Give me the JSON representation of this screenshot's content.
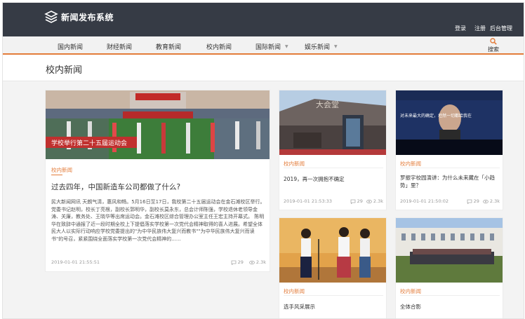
{
  "header": {
    "site_title": "新闻发布系统",
    "links": {
      "login": "登录",
      "register": "注册",
      "admin": "后台管理"
    }
  },
  "nav": {
    "items": [
      {
        "label": "国内新闻"
      },
      {
        "label": "财经新闻"
      },
      {
        "label": "教育新闻"
      },
      {
        "label": "校内新闻"
      },
      {
        "label": "国际新闻"
      },
      {
        "label": "娱乐新闻"
      }
    ],
    "search_label": "搜索"
  },
  "section": {
    "title": "校内新闻"
  },
  "featured": {
    "category": "校内新闻",
    "title": "过去四年，中国新造车公司都做了什么?",
    "summary": "民大新闻网讯 天朗气清，惠风和畅。5月16日至17日，我校第二十五届运动会在金石滩校区举行。党委书记赵明，校长丁亮根，副校长郭明华，副校长莫永东，总会计师陈强，学校退休老领导金涛、关廉，教务处、王晓华等出席运动会。金石滩校区综合管理办公室主任王宏主持开幕式。 陈明华在致辞中通报了近一段时期全校上下提倡落实学校第一次党代会精神取得的喜人进展。希望全体民大人以实际行动响应学校党委提出的\"为中华民族伟大复兴而教书\"\"为中华民族伟大复兴而读书\"的号召，紧紧围绕全面落实学校第一次党代会精神的......",
    "time": "2019-01-01 21:55:51",
    "comments": "29",
    "views": "2.3k",
    "banner_text": "学校举行第二十五届运动会"
  },
  "cards": [
    {
      "category": "校内新闻",
      "title": "2019，再一次拥抱不确定",
      "time": "2019-01-01 21:53:33",
      "comments": "29",
      "views": "2.3k",
      "sign": "大会堂"
    },
    {
      "category": "校内新闻",
      "title": "罗振宇校园演讲：为什么未来藏在「小趋势」里？",
      "time": "2019-01-01 21:50:02",
      "comments": "29",
      "views": "2.3k",
      "screen_text": "对未来最大的确定，坦然一切都给我在"
    },
    {
      "category": "校内新闻",
      "title": "选手风采展示"
    },
    {
      "category": "校内新闻",
      "title": "全体合影"
    }
  ],
  "colors": {
    "header": "#363b45",
    "accent": "#e37c3a",
    "nav_bg": "#f2f2f2",
    "content_bg": "#f3f3f3"
  }
}
